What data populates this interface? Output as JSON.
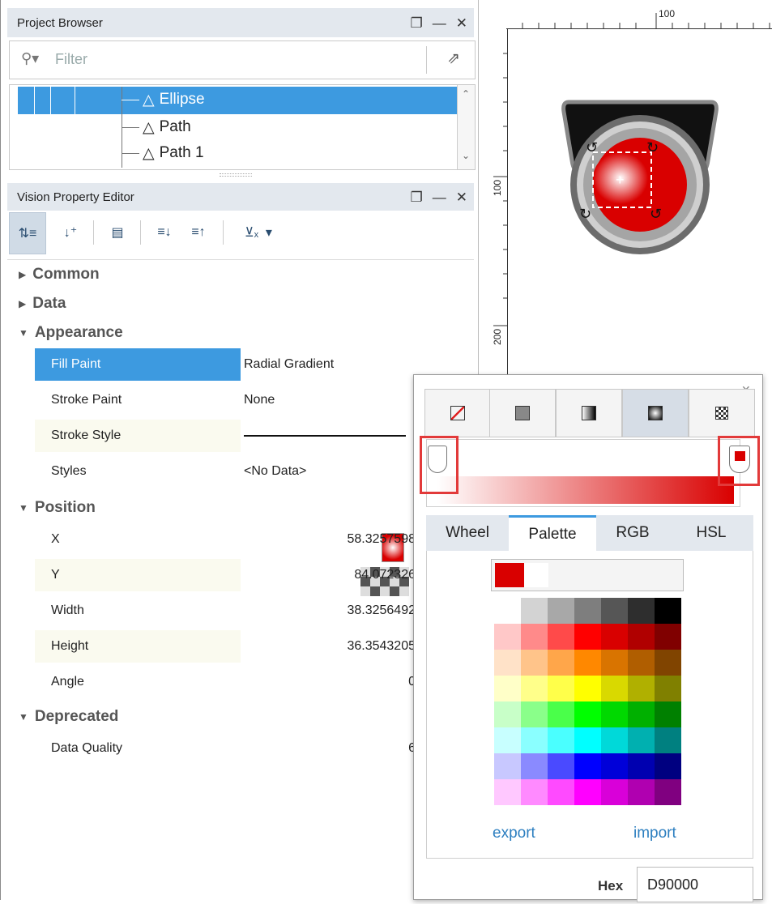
{
  "project_browser": {
    "title": "Project Browser",
    "filter_placeholder": "Filter",
    "items": [
      {
        "label": "Ellipse",
        "selected": true
      },
      {
        "label": "Path",
        "selected": false
      },
      {
        "label": "Path 1",
        "selected": false
      }
    ]
  },
  "property_editor": {
    "title": "Vision Property Editor",
    "categories": {
      "common": "Common",
      "data": "Data",
      "appearance": "Appearance",
      "position": "Position",
      "deprecated": "Deprecated"
    },
    "properties": {
      "fill_paint": {
        "name": "Fill Paint",
        "value": "Radial Gradient"
      },
      "stroke_paint": {
        "name": "Stroke Paint",
        "value": "None"
      },
      "stroke_style": {
        "name": "Stroke Style",
        "value": ""
      },
      "styles": {
        "name": "Styles",
        "value": "<No Data>"
      },
      "x": {
        "name": "X",
        "value": "58.3257598"
      },
      "y": {
        "name": "Y",
        "value": "84.072326"
      },
      "width": {
        "name": "Width",
        "value": "38.3256492"
      },
      "height": {
        "name": "Height",
        "value": "36.3543205"
      },
      "angle": {
        "name": "Angle",
        "value": "0"
      },
      "data_quality": {
        "name": "Data Quality",
        "value": "6"
      }
    }
  },
  "canvas": {
    "ruler_top_label": "100",
    "ruler_left_label_1": "100",
    "ruler_left_label_2": "200"
  },
  "paint_popup": {
    "color_tabs": [
      "Wheel",
      "Palette",
      "RGB",
      "HSL"
    ],
    "active_tab": "Palette",
    "export_label": "export",
    "import_label": "import",
    "hex_label": "Hex",
    "hex_value": "D90000",
    "selected_color": "#d90000",
    "gradient_start": "#ffffff",
    "gradient_end": "#d90000"
  },
  "colors": {
    "accent_blue": "#3d9ae0",
    "header_bg": "#e3e8ee",
    "highlight_red": "#e23a3a"
  }
}
